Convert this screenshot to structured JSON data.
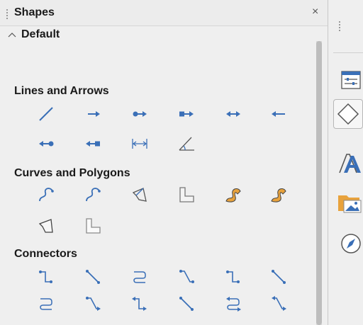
{
  "panel": {
    "title": "Shapes",
    "close_label": "×",
    "expander": {
      "label": "Default",
      "expanded": true
    },
    "sections": {
      "lines": {
        "title": "Lines and Arrows",
        "items": [
          "line",
          "line-arrow-end",
          "line-circle-arrow",
          "line-square-arrow",
          "line-double-arrow",
          "line-arrow-start",
          "circle-line",
          "square-line",
          "dimension-line",
          "angle-line"
        ]
      },
      "curves": {
        "title": "Curves and Polygons",
        "items": [
          "curve",
          "freeform-curve",
          "polygon",
          "polygon-45",
          "curve-filled",
          "freeform-filled",
          "polygon-filled",
          "polygon-45-filled"
        ]
      },
      "connectors": {
        "title": "Connectors",
        "items": [
          "connector",
          "straight-connector",
          "curved-connector",
          "line-connector",
          "connector-arrow",
          "straight-connector-arrow",
          "curved-connector-arrows",
          "line-connector-arrow",
          "connector-arrows",
          "straight-connector-arrows",
          "curved-connector-arrows-2",
          "line-connector-arrows"
        ]
      }
    }
  },
  "sidebar": {
    "buttons": [
      "properties",
      "shapes",
      "styles",
      "gallery",
      "navigator"
    ],
    "selected": "shapes"
  },
  "colors": {
    "accent": "#3a6fb7",
    "fill": "#e8a23c"
  }
}
